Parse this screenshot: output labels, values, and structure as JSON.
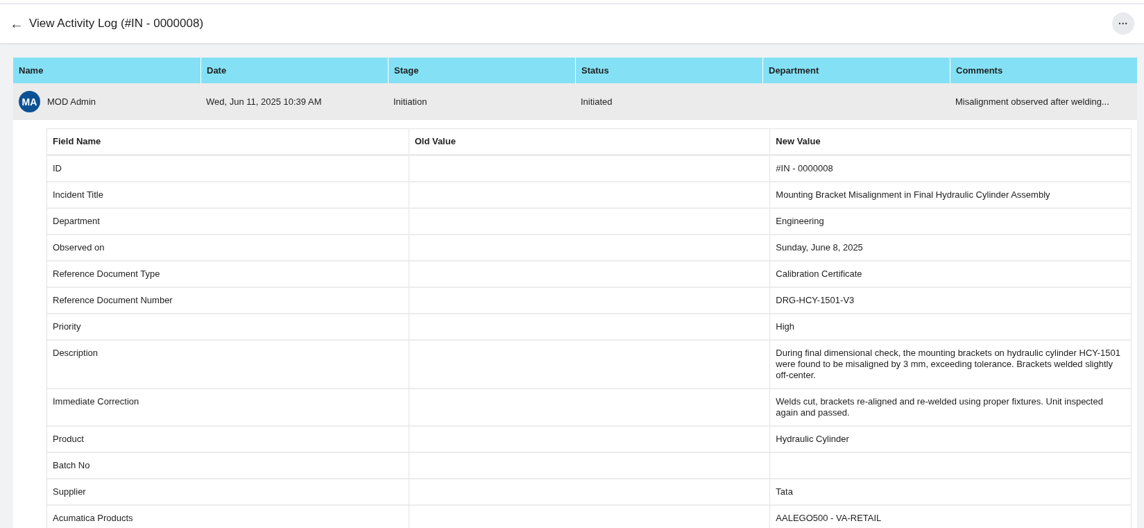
{
  "header": {
    "back": "←",
    "title": "View Activity Log (#IN - 0000008)",
    "more": "···"
  },
  "log_table": {
    "columns": [
      "Name",
      "Date",
      "Stage",
      "Status",
      "Department",
      "Comments"
    ],
    "rows": [
      {
        "avatar": "MA",
        "name": "MOD Admin",
        "date": "Wed, Jun 11, 2025 10:39 AM",
        "stage": "Initiation",
        "status": "Initiated",
        "comments": "Misalignment observed after welding...",
        "expanded": true,
        "changes": {
          "columns": [
            "Field Name",
            "Old Value",
            "New Value"
          ],
          "rows": [
            {
              "field": "ID",
              "new_value": "#IN - 0000008"
            },
            {
              "field": "Incident Title",
              "new_value": "Mounting Bracket Misalignment in Final Hydraulic Cylinder Assembly"
            },
            {
              "field": "Department",
              "new_value": "Engineering"
            },
            {
              "field": "Observed on",
              "new_value": "Sunday, June 8, 2025"
            },
            {
              "field": "Reference Document Type",
              "new_value": "Calibration Certificate"
            },
            {
              "field": "Reference Document Number",
              "new_value": "DRG-HCY-1501-V3"
            },
            {
              "field": "Priority",
              "new_value": "High"
            },
            {
              "field": "Description",
              "new_value": "During final dimensional check, the mounting brackets on hydraulic cylinder HCY-1501 were found to be misaligned by 3 mm, exceeding tolerance. Brackets welded slightly off-center."
            },
            {
              "field": "Immediate Correction",
              "new_value": "Welds cut, brackets re-aligned and re-welded using proper fixtures. Unit inspected again and passed."
            },
            {
              "field": "Product",
              "new_value": "Hydraulic Cylinder"
            },
            {
              "field": "Batch No"
            },
            {
              "field": "Supplier",
              "new_value": "Tata"
            },
            {
              "field": "Acumatica Products",
              "new_value": "AALEGO500 - VA-RETAIL"
            }
          ]
        }
      }
    ]
  }
}
